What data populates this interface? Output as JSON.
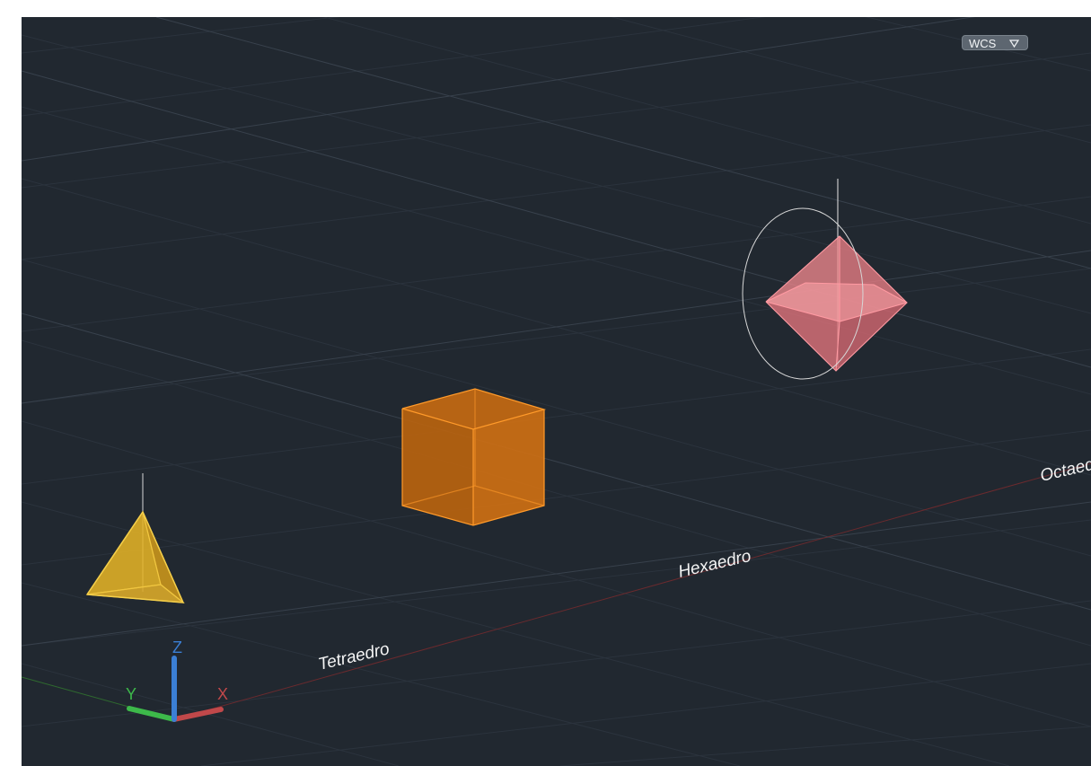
{
  "viewport": {
    "background": "#212830",
    "view_cube": {
      "label": "WCS",
      "icon": "chevron-down-icon"
    },
    "solids": [
      {
        "label": "Tetraedro",
        "type": "tetrahedron",
        "color": "#e3b226"
      },
      {
        "label": "Hexaedro",
        "type": "hexahedron",
        "color": "#f28c1a"
      },
      {
        "label": "Octaedro",
        "type": "octahedron",
        "color": "#f28a90"
      }
    ],
    "ucs_icon": {
      "x_label": "X",
      "y_label": "Y",
      "z_label": "Z",
      "x_color": "#c0484a",
      "y_color": "#3db94a",
      "z_color": "#3b7fd4"
    }
  }
}
